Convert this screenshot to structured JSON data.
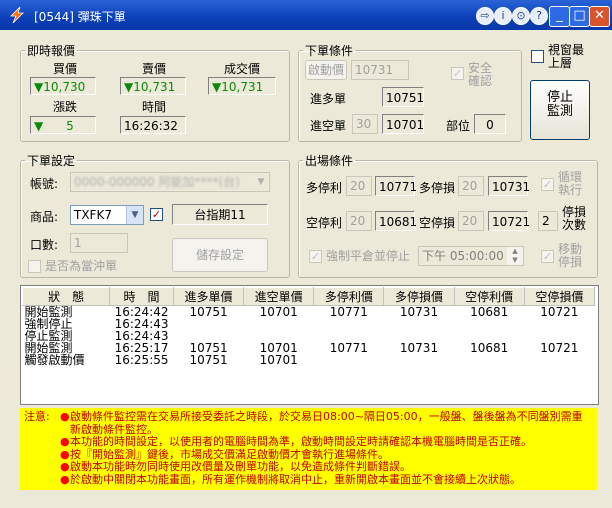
{
  "window": {
    "title": "[0544] 彈珠下單"
  },
  "quotes": {
    "legend": "即時報價",
    "buy_label": "買價",
    "sell_label": "賣價",
    "deal_label": "成交價",
    "buy": "▼10,730",
    "sell": "▼10,731",
    "deal": "▼10,731",
    "change_label": "漲跌",
    "change": "▼      5",
    "time_label": "時間",
    "time": "16:26:32"
  },
  "conditions": {
    "legend": "下單條件",
    "trigger_button": "啟動價",
    "trigger_value": "10731",
    "safety_label": "安全確認",
    "long_entry_label": "進多單",
    "long_entry": "10751",
    "short_entry_label": "進空單",
    "short_offset": "30",
    "short_entry": "10701",
    "position_label": "部位",
    "position": "0"
  },
  "always_on_top": "視窗最上層",
  "stop_monitor": "停止監測",
  "settings": {
    "legend": "下單設定",
    "account_label": "帳號:",
    "account": "0000-000000 阿能加****(台)",
    "product_label": "商品:",
    "product": "TXFK7",
    "product_name": "台指期11",
    "qty_label": "口數:",
    "qty": "1",
    "daytrade_label": "是否為當沖單",
    "save_button": "儲存設定"
  },
  "exit": {
    "legend": "出場條件",
    "long_tp_label": "多停利",
    "long_tp_offset": "20",
    "long_tp": "10771",
    "long_sl_label": "多停損",
    "long_sl_offset": "20",
    "long_sl": "10731",
    "loop_label": "循環執行",
    "short_tp_label": "空停利",
    "short_tp_offset": "20",
    "short_tp": "10681",
    "short_sl_label": "空停損",
    "short_sl_offset": "20",
    "short_sl": "10721",
    "stop_count": "2",
    "stop_count_label": "停損次數",
    "force_label": "強制平倉並停止",
    "force_time": "下午 05:00:00",
    "move_stop_label": "移動停損"
  },
  "log": {
    "headers": [
      "狀　態",
      "時　間",
      "進多單價",
      "進空單價",
      "多停利價",
      "多停損價",
      "空停利價",
      "空停損價"
    ],
    "rows": [
      [
        "開始監測",
        "16:24:42",
        "10751",
        "10701",
        "10771",
        "10731",
        "10681",
        "10721"
      ],
      [
        "強制停止",
        "16:24:43",
        "",
        "",
        "",
        "",
        "",
        ""
      ],
      [
        "停止監測",
        "16:24:43",
        "",
        "",
        "",
        "",
        "",
        ""
      ],
      [
        "開始監測",
        "16:25:17",
        "10751",
        "10701",
        "10771",
        "10731",
        "10681",
        "10721"
      ],
      [
        "觸發啟動價",
        "16:25:55",
        "10751",
        "10701",
        "",
        "",
        "",
        ""
      ]
    ]
  },
  "notice": {
    "head": "注意:",
    "items": [
      "啟動條件監控需在交易所接受委託之時段，於交易日08:00~隔日05:00，一般盤、盤後盤為不同盤別需重新啟動條件監控。",
      "本功能的時間設定，以使用者的電腦時間為準，啟動時間設定時請確認本機電腦時間是否正確。",
      "按『開始監測』鍵後，市場成交價滿足啟動價才會執行進場條件。",
      "啟動本功能時勿同時使用改價量及刪單功能，以免造成條件判斷錯誤。",
      "於啟動中關閉本功能畫面，所有運作機制將取消中止，重新開啟本畫面並不會接續上次狀態。"
    ]
  },
  "colors": {
    "quote_green": "#0a8a0a",
    "notice_bg": "#ffff00",
    "notice_text": "#c00000",
    "title_bar": "#0a3fb8"
  }
}
